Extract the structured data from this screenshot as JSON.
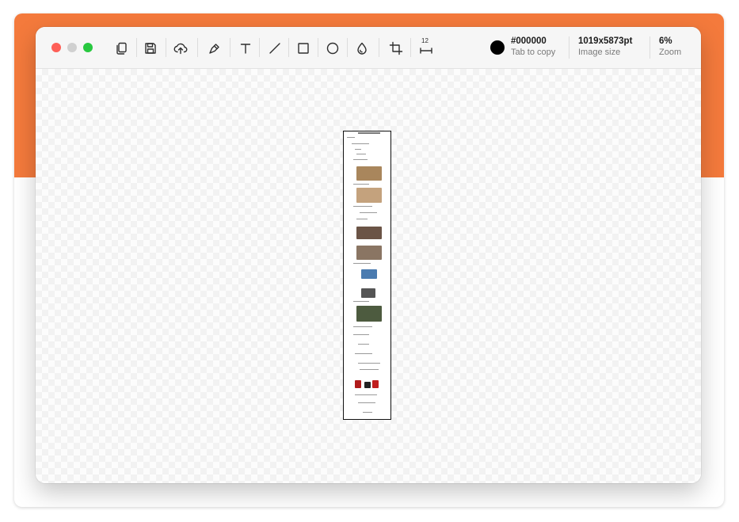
{
  "window": {
    "controls": [
      "close",
      "minimize",
      "maximize"
    ]
  },
  "toolbar": {
    "tools": [
      {
        "name": "copy-icon",
        "label": "Copy"
      },
      {
        "name": "save-icon",
        "label": "Save"
      },
      {
        "name": "upload-cloud-icon",
        "label": "Upload"
      },
      {
        "name": "pen-icon",
        "label": "Pen"
      },
      {
        "name": "text-icon",
        "label": "Text"
      },
      {
        "name": "line-icon",
        "label": "Line"
      },
      {
        "name": "rectangle-icon",
        "label": "Rectangle"
      },
      {
        "name": "ellipse-icon",
        "label": "Ellipse"
      },
      {
        "name": "blur-drop-icon",
        "label": "Blur"
      },
      {
        "name": "crop-icon",
        "label": "Crop"
      },
      {
        "name": "measure-icon",
        "label": "Measure"
      }
    ],
    "measure_badge": "12",
    "color": {
      "hex": "#000000",
      "value": "#000000",
      "caption": "Tab to copy"
    },
    "image_size": {
      "value": "1019x5873pt",
      "caption": "Image size"
    },
    "zoom": {
      "value": "6%",
      "caption": "Zoom"
    }
  },
  "colors": {
    "accent_background": "#f47a3c",
    "selected_color": "#000000",
    "close": "#fe5f57",
    "minimize": "#d0d0d0",
    "maximize": "#28c840"
  }
}
